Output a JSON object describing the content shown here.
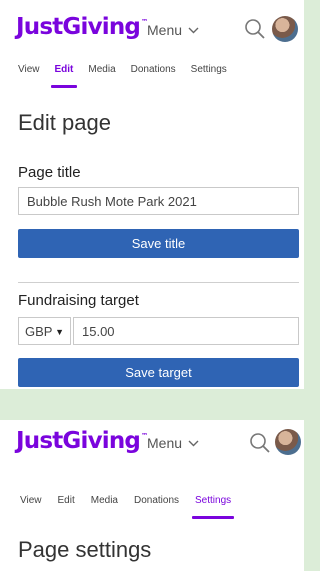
{
  "brand": {
    "logo_text": "JustGiving",
    "trademark": "™",
    "color": "#7a04dd"
  },
  "header": {
    "menu_label": "Menu"
  },
  "tabs": [
    {
      "label": "View",
      "active": false
    },
    {
      "label": "Edit",
      "active": true
    },
    {
      "label": "Media",
      "active": false
    },
    {
      "label": "Donations",
      "active": false
    },
    {
      "label": "Settings",
      "active": false
    }
  ],
  "edit_page": {
    "heading": "Edit page",
    "page_title_label": "Page title",
    "page_title_value": "Bubble Rush Mote Park 2021",
    "save_title_button": "Save title",
    "target_label": "Fundraising target",
    "currency": "GBP",
    "target_value": "15.00",
    "save_target_button": "Save target"
  },
  "settings_view": {
    "tabs": [
      {
        "label": "View",
        "active": false
      },
      {
        "label": "Edit",
        "active": false
      },
      {
        "label": "Media",
        "active": false
      },
      {
        "label": "Donations",
        "active": false
      },
      {
        "label": "Settings",
        "active": true
      }
    ],
    "heading": "Page settings"
  },
  "colors": {
    "accent": "#7a04dd",
    "button": "#2f64b4",
    "background": "#dcedd8"
  }
}
